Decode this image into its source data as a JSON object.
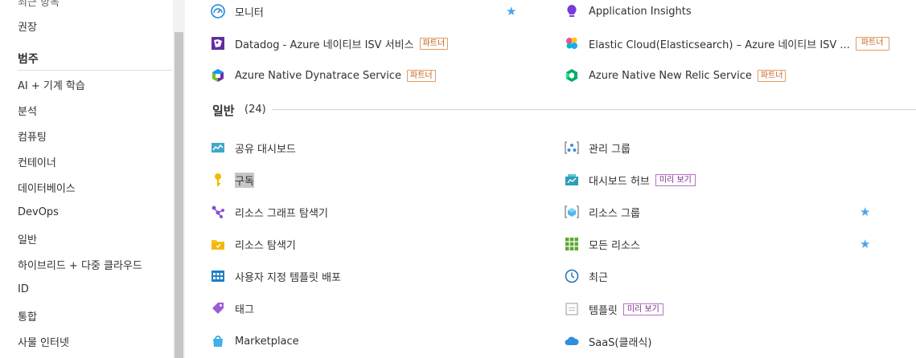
{
  "sidebar": {
    "partial_top": "최근 항목",
    "recommended": "권장",
    "categories_heading": "범주",
    "items": [
      "AI + 기계 학습",
      "분석",
      "컴퓨팅",
      "컨테이너",
      "데이터베이스",
      "DevOps",
      "일반",
      "하이브리드 + 다중 클라우드",
      "ID",
      "통합",
      "사물 인터넷"
    ]
  },
  "top_services": [
    {
      "label": "모니터",
      "icon": "gauge-icon",
      "star": true
    },
    {
      "label": "Application Insights",
      "icon": "lightbulb-icon"
    },
    {
      "label": "Datadog - Azure 네이티브 ISV 서비스",
      "icon": "datadog-icon",
      "badge": "파트너"
    },
    {
      "label": "Elastic Cloud(Elasticsearch) – Azure 네이티브 ISV ...",
      "icon": "elastic-icon",
      "badge": "파트너"
    },
    {
      "label": "Azure Native Dynatrace Service",
      "icon": "dynatrace-icon",
      "badge": "파트너"
    },
    {
      "label": "Azure Native New Relic Service",
      "icon": "newrelic-icon",
      "badge": "파트너"
    }
  ],
  "section": {
    "title": "일반",
    "count": "(24)"
  },
  "general_left": [
    {
      "label": "공유 대시보드",
      "icon": "dashboard-icon"
    },
    {
      "label": "구독",
      "icon": "key-icon"
    },
    {
      "label": "리소스 그래프 탐색기",
      "icon": "graph-icon"
    },
    {
      "label": "리소스 탐색기",
      "icon": "folder-icon"
    },
    {
      "label": "사용자 지정 템플릿 배포",
      "icon": "grid-deploy-icon"
    },
    {
      "label": "태그",
      "icon": "tag-icon"
    },
    {
      "label": "Marketplace",
      "icon": "shopping-bag-icon"
    }
  ],
  "general_right": [
    {
      "label": "관리 그룹",
      "icon": "management-group-icon"
    },
    {
      "label": "대시보드 허브",
      "icon": "dashboard-hub-icon",
      "badge": "미리 보기"
    },
    {
      "label": "리소스 그룹",
      "icon": "resource-group-icon",
      "star": true
    },
    {
      "label": "모든 리소스",
      "icon": "all-resources-icon",
      "star": true
    },
    {
      "label": "최근",
      "icon": "clock-icon"
    },
    {
      "label": "템플릿",
      "icon": "template-icon",
      "badge": "미리 보기"
    },
    {
      "label": "SaaS(클래식)",
      "icon": "saas-cloud-icon"
    }
  ],
  "colors": {
    "star": "#4aa3e8",
    "partner_badge": "#c15d1a",
    "preview_badge": "#7a2a8a"
  }
}
